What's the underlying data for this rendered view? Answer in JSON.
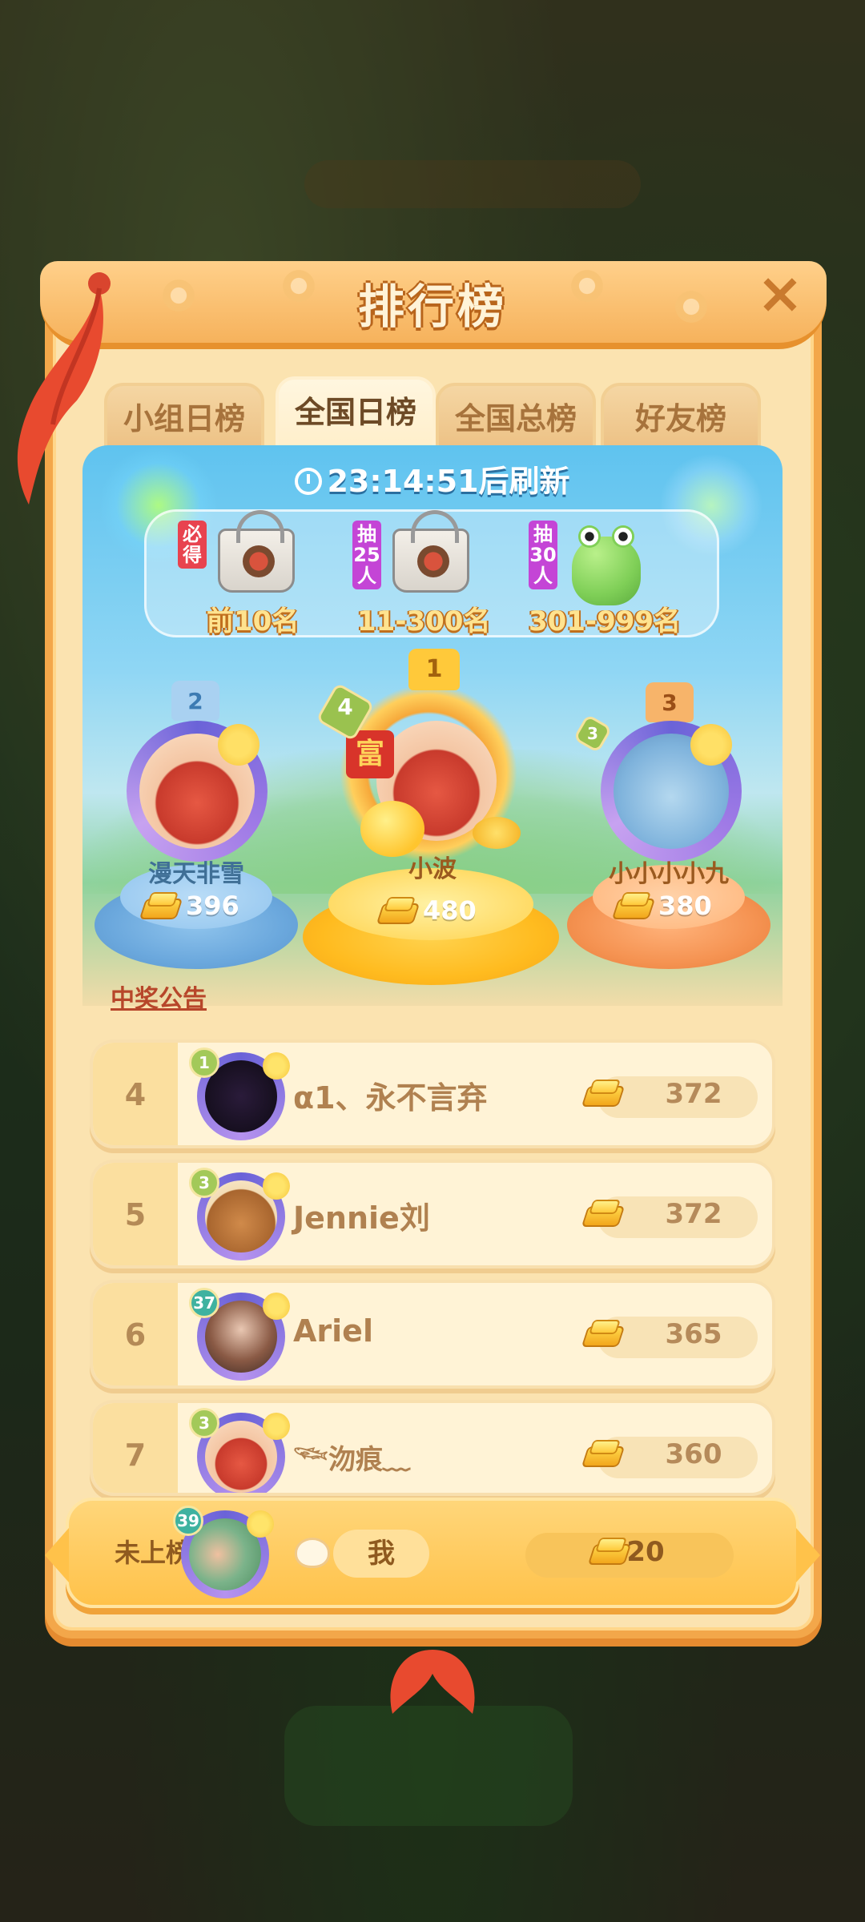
{
  "panel": {
    "title": "排行榜",
    "close_icon": "close-icon"
  },
  "tabs": [
    {
      "label": "小组日榜",
      "active": false
    },
    {
      "label": "全国日榜",
      "active": true
    },
    {
      "label": "全国总榜",
      "active": false
    },
    {
      "label": "好友榜",
      "active": false
    }
  ],
  "timer": {
    "time": "23:14:51",
    "suffix": "后刷新"
  },
  "rewards": [
    {
      "tag": "必得",
      "prize_icon": "tote-bag-icon",
      "range": "前10名"
    },
    {
      "tag": "抽25人",
      "prize_icon": "tote-bag-icon",
      "range": "11-300名"
    },
    {
      "tag": "抽30人",
      "prize_icon": "frog-plush-icon",
      "range": "301-999名"
    }
  ],
  "podium": {
    "first": {
      "rank": "1",
      "level": "4",
      "name": "小波",
      "score": "480"
    },
    "second": {
      "rank": "2",
      "name": "漫天非雪",
      "score": "396"
    },
    "third": {
      "rank": "3",
      "level": "3",
      "name": "小小小小九",
      "score": "380"
    }
  },
  "notice_link": "中奖公告",
  "list": [
    {
      "rank": "4",
      "level": "1",
      "name": "α1、永不言弃",
      "score": "372"
    },
    {
      "rank": "5",
      "level": "3",
      "name": "Jennie刘",
      "score": "372"
    },
    {
      "rank": "6",
      "level": "37",
      "name": "Ariel",
      "score": "365"
    },
    {
      "rank": "7",
      "level": "3",
      "name": "𓆝沕痕﹏",
      "score": "360"
    }
  ],
  "me": {
    "rank_label": "未上榜",
    "level": "39",
    "name": "我",
    "score": "20"
  },
  "colors": {
    "panel_border": "#f3a74a",
    "panel_bg": "#fbe3b0",
    "accent_gold": "#ffc24a",
    "notice_red": "#b7462a"
  }
}
